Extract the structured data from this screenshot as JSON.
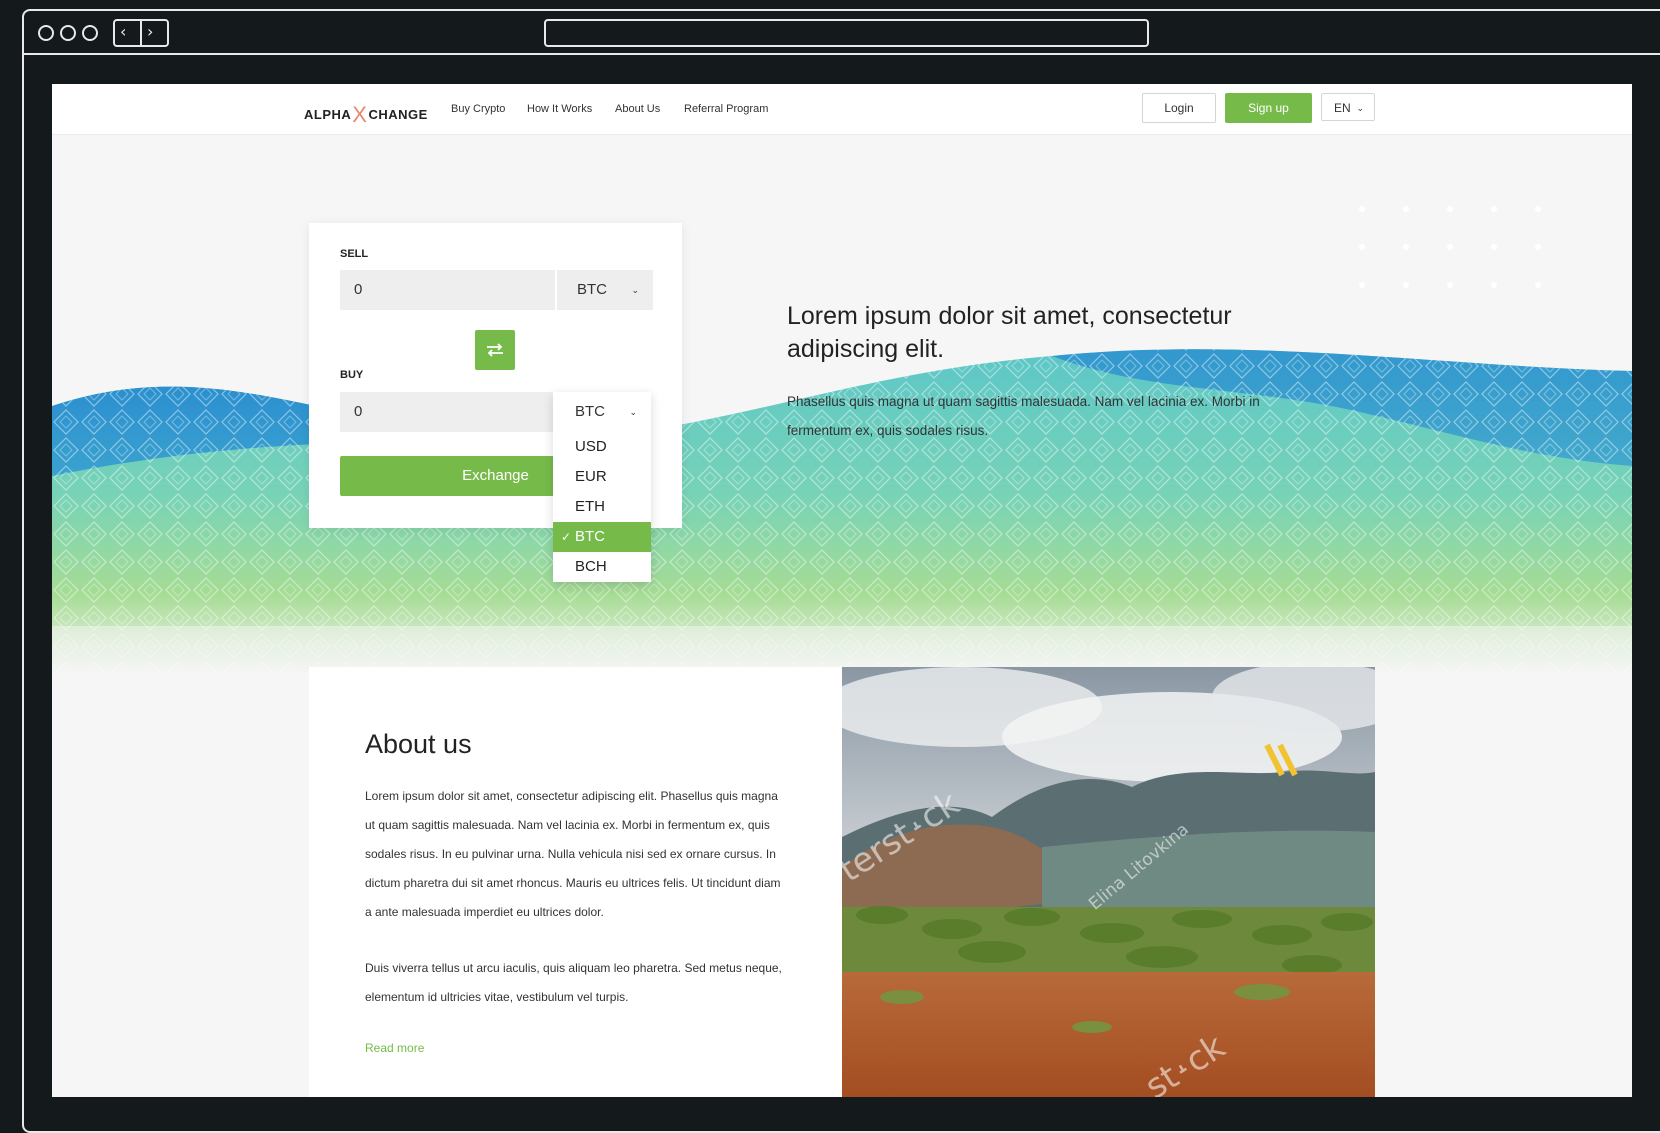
{
  "brand": {
    "name_left": "ALPHA",
    "name_x": "X",
    "name_right": "CHANGE",
    "accent": "#76bb4a",
    "logo_accent": "#e8896b"
  },
  "nav": {
    "items": [
      "Buy Crypto",
      "How It Works",
      "About Us",
      "Referral Program"
    ],
    "login": "Login",
    "signup": "Sign up",
    "language": "EN"
  },
  "exchange": {
    "sell_label": "SELL",
    "sell_value": "0",
    "sell_currency": "BTC",
    "swap_icon": "swap-arrows-icon",
    "buy_label": "BUY",
    "buy_value": "0",
    "buy_currency": "BTC",
    "button": "Exchange",
    "options": [
      "USD",
      "EUR",
      "ETH",
      "BTC",
      "BCH"
    ],
    "selected_option": "BTC"
  },
  "hero": {
    "title": "Lorem ipsum dolor sit amet, consectetur adipiscing elit.",
    "subtitle": "Phasellus quis magna ut quam sagittis malesuada. Nam vel lacinia ex. Morbi in fermentum ex, quis sodales risus."
  },
  "about": {
    "title": "About us",
    "paragraph1": "Lorem ipsum dolor sit amet, consectetur adipiscing elit. Phasellus quis magna ut quam sagittis malesuada. Nam vel lacinia ex. Morbi in fermentum ex, quis sodales risus. In eu pulvinar urna. Nulla vehicula nisi sed ex ornare cursus. In dictum pharetra dui sit amet rhoncus. Mauris eu ultrices felis. Ut tincidunt diam a ante malesuada imperdiet eu ultrices dolor.",
    "paragraph2": "Duis viverra tellus ut arcu iaculis, quis aliquam leo pharetra. Sed metus neque, elementum id ultricies vitae, vestibulum vel turpis.",
    "read_more": "Read more",
    "photo": {
      "watermark_1": "terst˔ck",
      "watermark_2": "Elina Litovkina",
      "watermark_3": "st˔ck"
    }
  }
}
